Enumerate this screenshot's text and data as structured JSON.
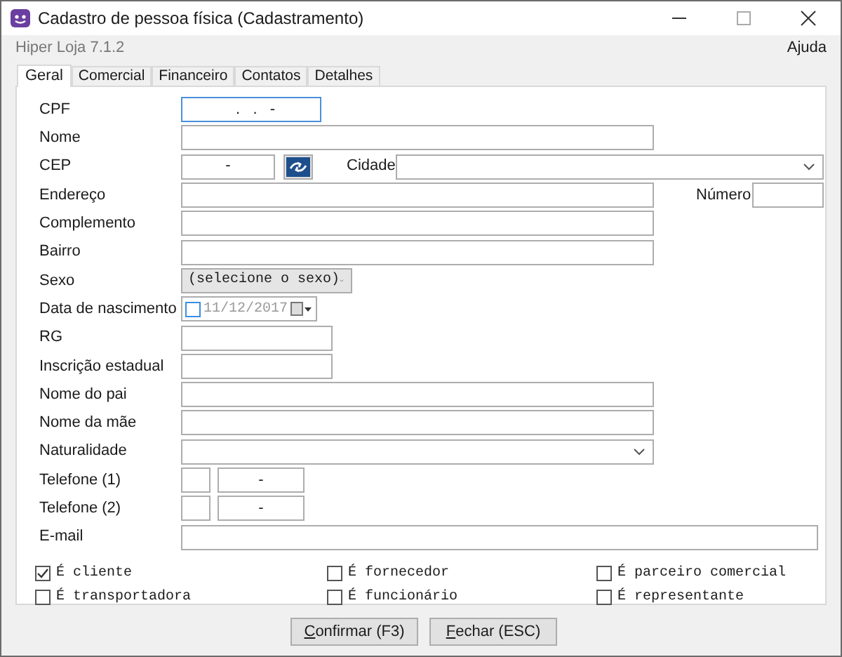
{
  "window": {
    "title": "Cadastro de pessoa física (Cadastramento)"
  },
  "app_version": "Hiper Loja 7.1.2",
  "menu": [
    "Ajuda"
  ],
  "tabs": [
    {
      "label": "Geral",
      "selected": true
    },
    {
      "label": "Comercial",
      "selected": false
    },
    {
      "label": "Financeiro",
      "selected": false
    },
    {
      "label": "Contatos",
      "selected": false
    },
    {
      "label": "Detalhes",
      "selected": false
    }
  ],
  "rows": [
    {
      "label": "CPF",
      "kind": "masked",
      "value": "  .   .   -",
      "focused": true
    },
    {
      "label": "Nome",
      "kind": "text"
    },
    {
      "label": "CEP",
      "kind": "cep",
      "value": "-",
      "extra_label": "Cidade"
    },
    {
      "label": "Endereço",
      "kind": "address",
      "extra_label": "Número"
    },
    {
      "label": "Complemento",
      "kind": "text"
    },
    {
      "label": "Bairro",
      "kind": "text"
    },
    {
      "label": "Sexo",
      "kind": "select",
      "value": "(selecione o sexo)"
    },
    {
      "label": "Data de nascimento",
      "kind": "date",
      "value": "11/12/2017",
      "checked": false
    },
    {
      "label": "RG",
      "kind": "short"
    },
    {
      "label": "Inscrição estadual",
      "kind": "short"
    },
    {
      "label": "Nome do pai",
      "kind": "text"
    },
    {
      "label": "Nome da mãe",
      "kind": "text"
    },
    {
      "label": "Naturalidade",
      "kind": "combo"
    },
    {
      "label": "Telefone (1)",
      "kind": "phone",
      "value": "-"
    },
    {
      "label": "Telefone (2)",
      "kind": "phone",
      "value": "-"
    },
    {
      "label": "E-mail",
      "kind": "wide"
    }
  ],
  "checkboxes": [
    {
      "label": "É cliente",
      "checked": true
    },
    {
      "label": "É fornecedor",
      "checked": false
    },
    {
      "label": "É parceiro comercial",
      "checked": false
    },
    {
      "label": "É transportadora",
      "checked": false
    },
    {
      "label": "É funcionário",
      "checked": false
    },
    {
      "label": "É representante",
      "checked": false
    }
  ],
  "buttons": [
    "Confirmar (F3)",
    "Fechar (ESC)"
  ]
}
